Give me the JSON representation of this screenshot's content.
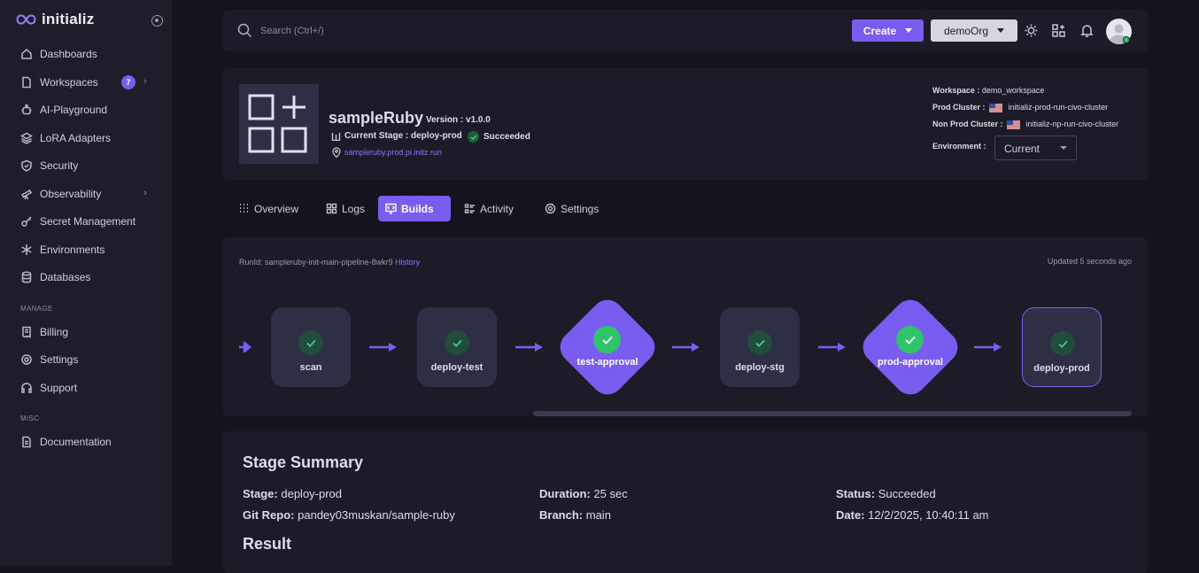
{
  "sidebar": {
    "brand": "initializ",
    "items": [
      {
        "label": "Dashboards",
        "icon": "home-icon"
      },
      {
        "label": "Workspaces",
        "icon": "file-icon",
        "badge": "7"
      },
      {
        "label": "AI-Playground",
        "icon": "robot-icon"
      },
      {
        "label": "LoRA Adapters",
        "icon": "layers-icon"
      },
      {
        "label": "Security",
        "icon": "shield-icon"
      },
      {
        "label": "Observability",
        "icon": "telescope-icon"
      },
      {
        "label": "Secret Management",
        "icon": "key-icon"
      },
      {
        "label": "Environments",
        "icon": "snowflake-icon"
      },
      {
        "label": "Databases",
        "icon": "database-icon"
      }
    ],
    "manage_label": "MANAGE",
    "manage_items": [
      {
        "label": "Billing",
        "icon": "receipt-icon"
      },
      {
        "label": "Settings",
        "icon": "gear-icon"
      },
      {
        "label": "Support",
        "icon": "headset-icon"
      }
    ],
    "misc_label": "MISC",
    "misc_items": [
      {
        "label": "Documentation",
        "icon": "document-icon"
      }
    ]
  },
  "topbar": {
    "search_placeholder": "Search (Ctrl+/)",
    "create_label": "Create",
    "org_label": "demoOrg"
  },
  "app": {
    "name": "sampleRuby",
    "version": "Version : v1.0.0",
    "current_stage": "Current Stage : deploy-prod",
    "status": "Succeeded",
    "url": "sampleruby.prod.pi.initz.run",
    "workspace_label": "Workspace :",
    "workspace": "demo_workspace",
    "prod_cluster_label": "Prod Cluster :",
    "prod_cluster": "initializ-prod-run-civo-cluster",
    "nonprod_cluster_label": "Non Prod Cluster :",
    "nonprod_cluster": "initializ-np-run-civo-cluster",
    "environment_label": "Environment :",
    "environment": "Current"
  },
  "tabs": [
    {
      "label": "Overview",
      "icon": "grid-icon"
    },
    {
      "label": "Logs",
      "icon": "logs-icon"
    },
    {
      "label": "Builds",
      "icon": "code-icon",
      "active": true
    },
    {
      "label": "Activity",
      "icon": "activity-icon"
    },
    {
      "label": "Settings",
      "icon": "gear-icon"
    }
  ],
  "pipeline": {
    "runid_label": "RunId: sampleruby-init-main-pipeline-8wkr9",
    "history_label": "History",
    "updated": "Updated 5 seconds ago",
    "stages": [
      {
        "label": "scan",
        "type": "box",
        "status": "succeeded"
      },
      {
        "label": "deploy-test",
        "type": "box",
        "status": "succeeded"
      },
      {
        "label": "test-approval",
        "type": "approval",
        "status": "succeeded"
      },
      {
        "label": "deploy-stg",
        "type": "box",
        "status": "succeeded"
      },
      {
        "label": "prod-approval",
        "type": "approval",
        "status": "succeeded"
      },
      {
        "label": "deploy-prod",
        "type": "box",
        "status": "succeeded",
        "current": true
      }
    ]
  },
  "summary": {
    "title": "Stage Summary",
    "stage_label": "Stage:",
    "stage": "deploy-prod",
    "duration_label": "Duration:",
    "duration": "25 sec",
    "status_label": "Status:",
    "status": "Succeeded",
    "repo_label": "Git Repo:",
    "repo": "pandey03muskan/sample-ruby",
    "branch_label": "Branch:",
    "branch": "main",
    "date_label": "Date:",
    "date": "12/2/2025, 10:40:11 am",
    "result_title": "Result"
  },
  "colors": {
    "accent": "#7b5cf0",
    "success": "#2fc46a",
    "background": "#14141f",
    "card": "#1c1c29"
  }
}
